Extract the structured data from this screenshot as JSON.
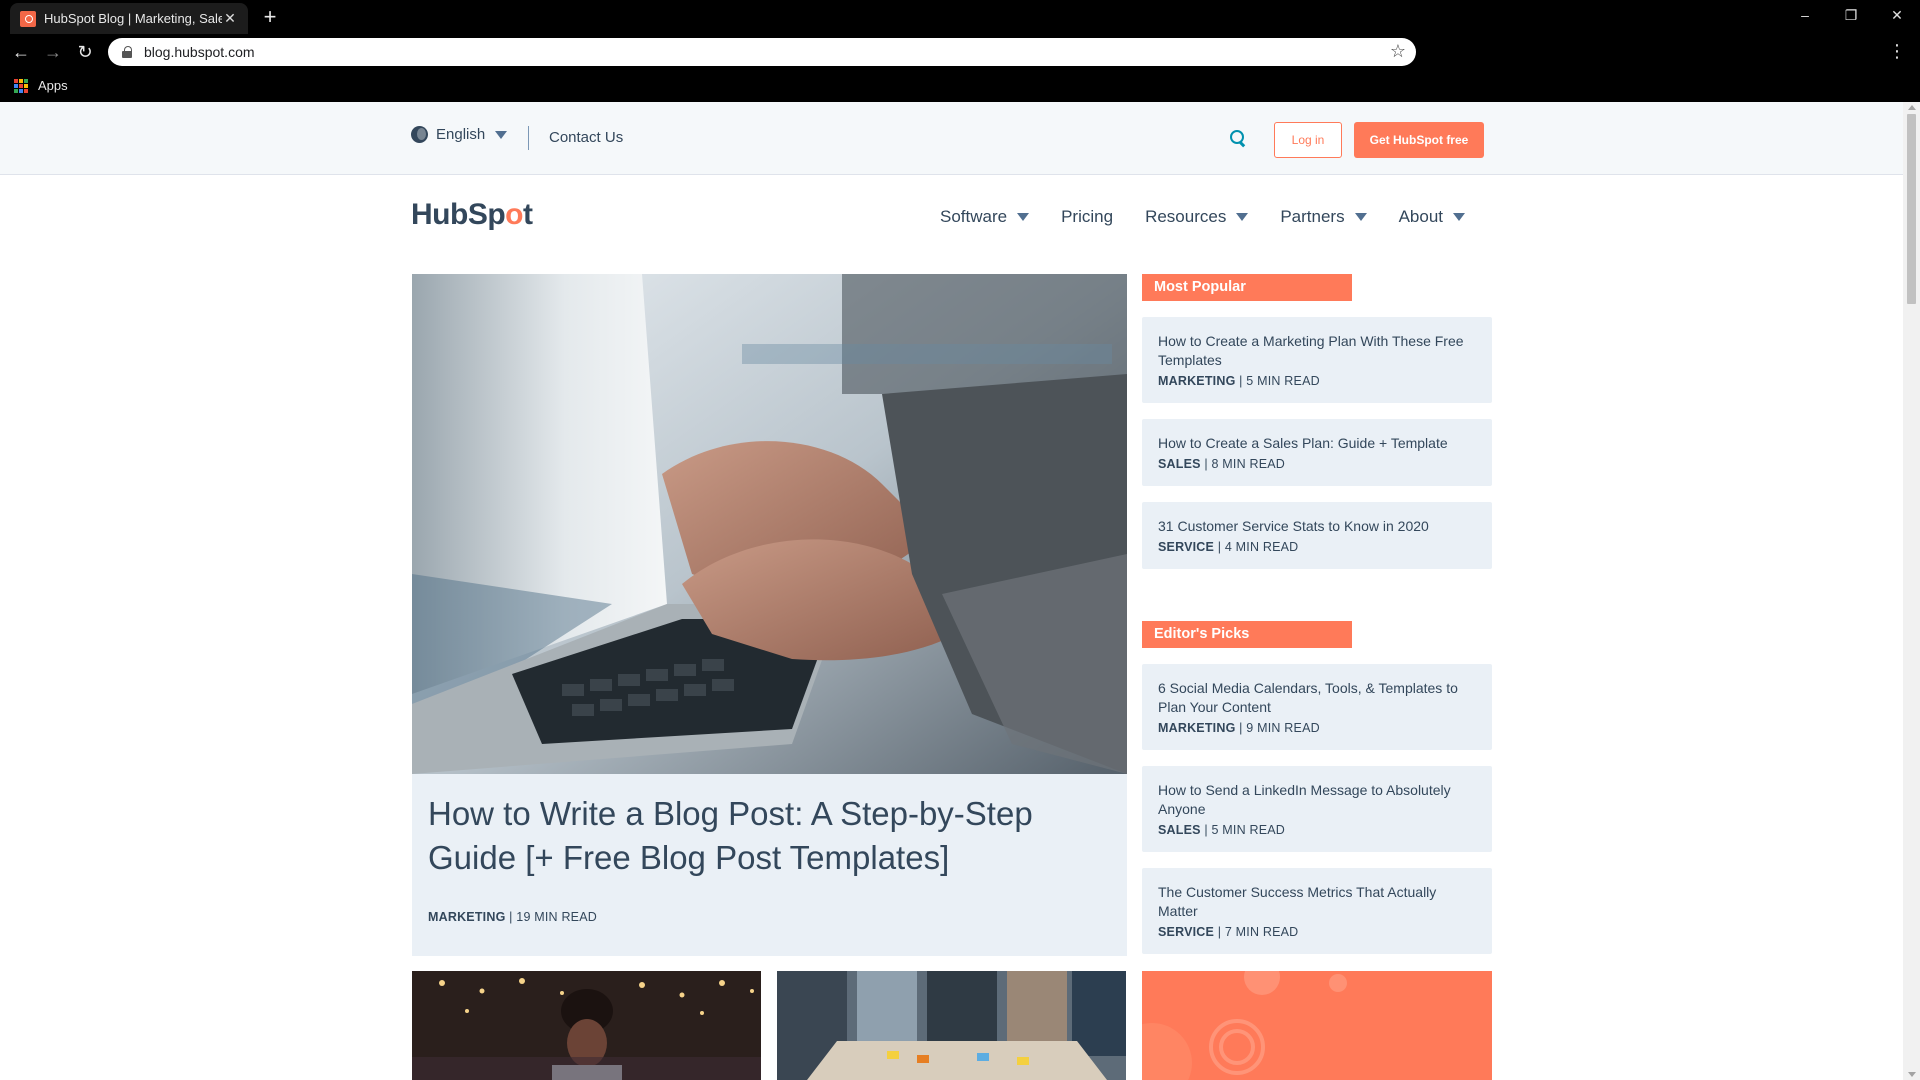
{
  "browser": {
    "tab_title": "HubSpot Blog | Marketing, Sales,",
    "tab_close": "✕",
    "new_tab": "+",
    "url": "blog.hubspot.com",
    "bookmark_apps": "Apps",
    "window_controls": {
      "minimize": "–",
      "restore": "❐",
      "close": "✕"
    },
    "nav": {
      "back": "←",
      "forward": "→",
      "reload": "↻",
      "star": "☆",
      "menu": "⋮"
    }
  },
  "utility": {
    "language": "English",
    "contact": "Contact Us",
    "login": "Log in",
    "cta": "Get HubSpot free"
  },
  "header": {
    "logo_parts": [
      "HubSp",
      "o",
      "t"
    ],
    "nav": [
      {
        "label": "Software",
        "dropdown": true
      },
      {
        "label": "Pricing",
        "dropdown": false
      },
      {
        "label": "Resources",
        "dropdown": true
      },
      {
        "label": "Partners",
        "dropdown": true
      },
      {
        "label": "About",
        "dropdown": true
      }
    ]
  },
  "hero": {
    "title": "How to Write a Blog Post: A Step-by-Step Guide [+ Free Blog Post Templates]",
    "category": "MARKETING",
    "read_time": "19 MIN READ"
  },
  "most_popular": {
    "heading": "Most Popular",
    "items": [
      {
        "title": "How to Create a Marketing Plan With These Free Templates",
        "category": "MARKETING",
        "read_time": "5 MIN READ"
      },
      {
        "title": "How to Create a Sales Plan: Guide + Template",
        "category": "SALES",
        "read_time": "8 MIN READ"
      },
      {
        "title": "31 Customer Service Stats to Know in 2020",
        "category": "SERVICE",
        "read_time": "4 MIN READ"
      }
    ]
  },
  "editors_picks": {
    "heading": "Editor's Picks",
    "items": [
      {
        "title": "6 Social Media Calendars, Tools, & Templates to Plan Your Content",
        "category": "MARKETING",
        "read_time": "9 MIN READ"
      },
      {
        "title": "How to Send a LinkedIn Message to Absolutely Anyone",
        "category": "SALES",
        "read_time": "5 MIN READ"
      },
      {
        "title": "The Customer Success Metrics That Actually Matter",
        "category": "SERVICE",
        "read_time": "7 MIN READ"
      }
    ]
  },
  "colors": {
    "accent": "#ff7a59",
    "text": "#33475b",
    "card_bg": "#eaf0f6",
    "search": "#0091ae"
  }
}
